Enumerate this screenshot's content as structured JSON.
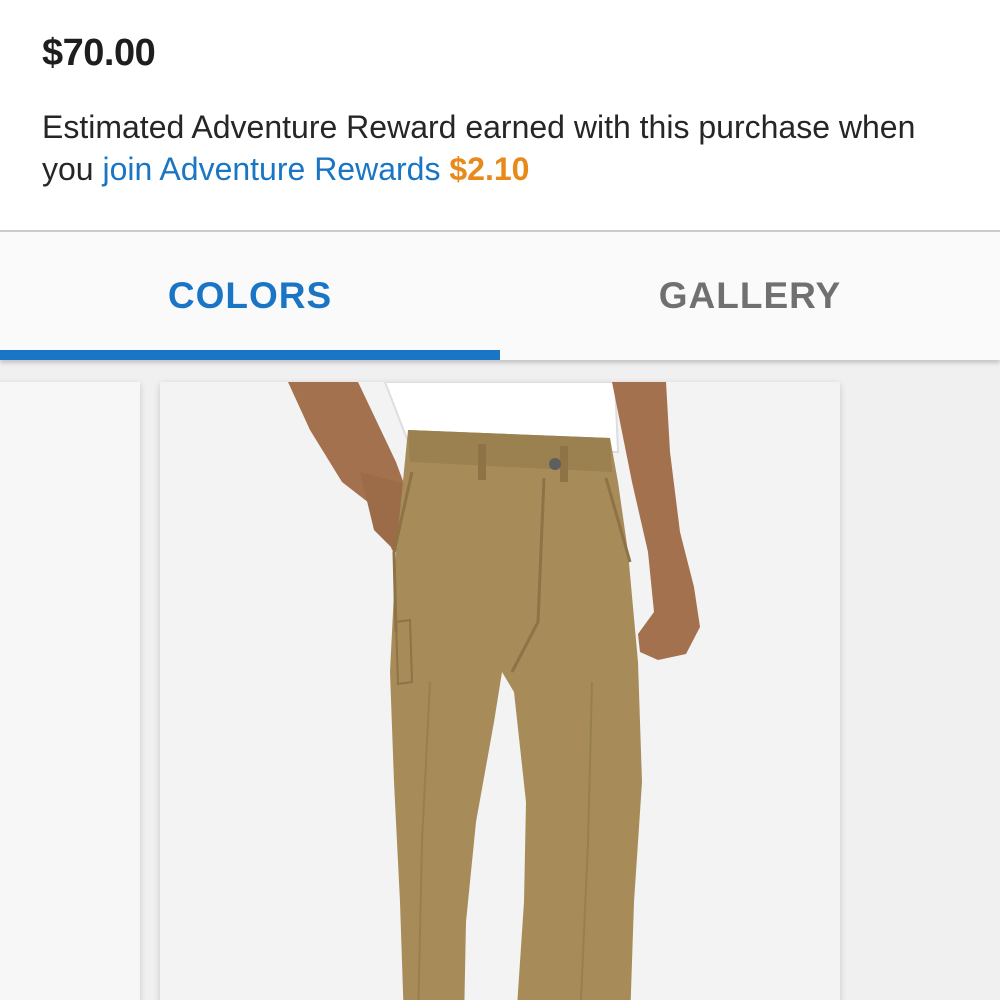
{
  "product": {
    "price": "$70.00",
    "reward_text_line": "Estimated Adventure Reward earned with this purchase when you",
    "reward_link": "join Adventure Rewards",
    "reward_amount": "$2.10"
  },
  "tabs": [
    {
      "label": "COLORS",
      "selected": true
    },
    {
      "label": "GALLERY",
      "selected": false
    }
  ],
  "colors": {
    "accent": "#1a76c4",
    "reward": "#e8891c",
    "pants": "#a78c5a"
  },
  "gallery": {
    "image": "khaki-pants-icon"
  }
}
